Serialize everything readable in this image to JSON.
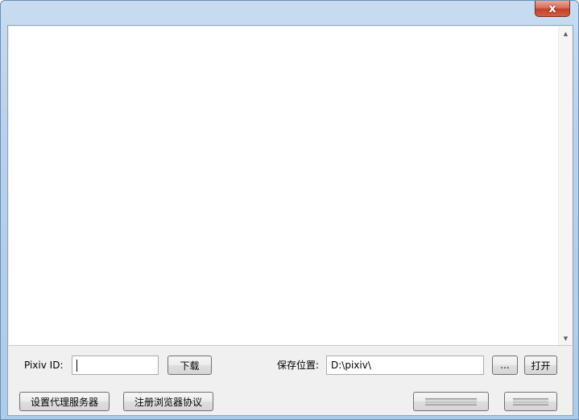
{
  "window": {
    "close_glyph": "x"
  },
  "log": {
    "content": ""
  },
  "scrollbar": {
    "up_glyph": "▲",
    "down_glyph": "▼"
  },
  "download_row": {
    "pixiv_id_label": "Pixiv ID:",
    "pixiv_id_value": "",
    "download_button": "下载",
    "save_location_label": "保存位置:",
    "save_path_value": "D:\\pixiv\\",
    "browse_button": "...",
    "open_button": "打开"
  },
  "bottom_row": {
    "proxy_button": "设置代理服务器",
    "register_protocol_button": "注册浏览器协议"
  }
}
